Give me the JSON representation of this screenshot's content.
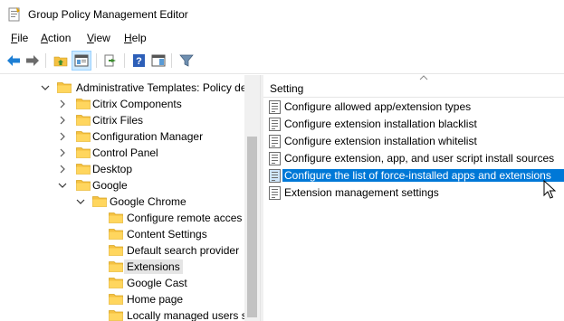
{
  "window": {
    "title": "Group Policy Management Editor",
    "icon": "gpo-editor-icon"
  },
  "menu": [
    {
      "label": "File",
      "accel": "F",
      "rest": "ile"
    },
    {
      "label": "Action",
      "accel": "A",
      "rest": "ction"
    },
    {
      "label": "View",
      "accel": "V",
      "rest": "iew"
    },
    {
      "label": "Help",
      "accel": "H",
      "rest": "elp"
    }
  ],
  "toolbar": {
    "buttons": [
      "back-arrow-icon",
      "forward-arrow-icon",
      "up-folder-icon",
      "show-hide-tree-icon",
      "export-list-icon",
      "help-icon",
      "properties-pane-icon",
      "filter-icon"
    ]
  },
  "tree": {
    "items": [
      {
        "label": "Administrative Templates: Policy de",
        "level": 0,
        "expanded": true
      },
      {
        "label": "Citrix Components",
        "level": 1,
        "expanded": false
      },
      {
        "label": "Citrix Files",
        "level": 1,
        "expanded": false
      },
      {
        "label": "Configuration Manager",
        "level": 1,
        "expanded": false
      },
      {
        "label": "Control Panel",
        "level": 1,
        "expanded": false
      },
      {
        "label": "Desktop",
        "level": 1,
        "expanded": false
      },
      {
        "label": "Google",
        "level": 1,
        "expanded": true
      },
      {
        "label": "Google Chrome",
        "level": 2,
        "expanded": true
      },
      {
        "label": "Configure remote acces",
        "level": 3,
        "leaf": true
      },
      {
        "label": "Content Settings",
        "level": 3,
        "leaf": true
      },
      {
        "label": "Default search provider",
        "level": 3,
        "leaf": true
      },
      {
        "label": "Extensions",
        "level": 3,
        "leaf": true,
        "selected": true
      },
      {
        "label": "Google Cast",
        "level": 3,
        "leaf": true
      },
      {
        "label": "Home page",
        "level": 3,
        "leaf": true
      },
      {
        "label": "Locally managed users s",
        "level": 3,
        "leaf": true
      }
    ]
  },
  "list": {
    "column": "Setting",
    "items": [
      {
        "label": "Configure allowed app/extension types"
      },
      {
        "label": "Configure extension installation blacklist"
      },
      {
        "label": "Configure extension installation whitelist"
      },
      {
        "label": "Configure extension, app, and user script install sources"
      },
      {
        "label": "Configure the list of force-installed apps and extensions",
        "selected": true
      },
      {
        "label": "Extension management settings"
      }
    ]
  },
  "colors": {
    "selection": "#0078d7",
    "folder": "#f5c142",
    "hover": "#cce8ff"
  }
}
